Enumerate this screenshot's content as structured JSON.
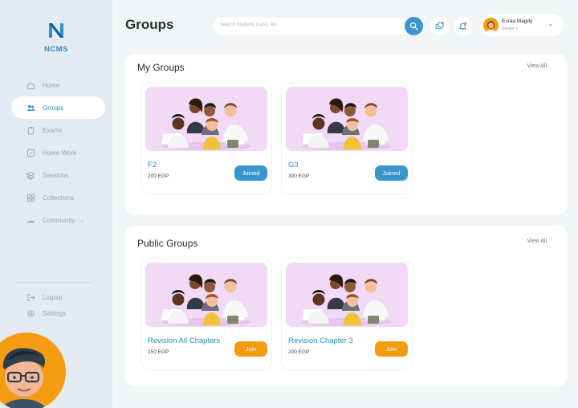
{
  "app": {
    "logo_text": "NCMS"
  },
  "sidebar": {
    "items": [
      {
        "label": "Home",
        "icon": "home-icon"
      },
      {
        "label": "Groups",
        "icon": "users-icon",
        "active": true
      },
      {
        "label": "Exams",
        "icon": "clipboard-icon"
      },
      {
        "label": "Home Work",
        "icon": "edit-icon"
      },
      {
        "label": "Sessions",
        "icon": "layers-icon"
      },
      {
        "label": "Collections",
        "icon": "grid-icon"
      },
      {
        "label": "Community",
        "icon": "broadcast-icon"
      }
    ],
    "bottom": [
      {
        "label": "Logout",
        "icon": "logout-icon"
      },
      {
        "label": "Settings",
        "icon": "gear-icon"
      }
    ]
  },
  "header": {
    "title": "Groups",
    "search_placeholder": "Search Student, Class, etc",
    "user": {
      "name": "Esraa Magdy",
      "role": "Senior 1"
    }
  },
  "my_groups": {
    "title": "My Groups",
    "view_all": "View All",
    "cards": [
      {
        "name": "F2",
        "price": "200 EGP",
        "action": "Joined"
      },
      {
        "name": "G3",
        "price": "300 EGP",
        "action": "Joined"
      }
    ]
  },
  "public_groups": {
    "title": "Public Groups",
    "view_all": "View All",
    "cards": [
      {
        "name": "Revision All Chapters",
        "price": "150 EGP",
        "action": "Join"
      },
      {
        "name": "Revision Chapter 3",
        "price": "200 EGP",
        "action": "Join"
      }
    ]
  },
  "colors": {
    "accent": "#3b96cf",
    "orange": "#f39a0e",
    "sidebar": "#e3eaf2"
  }
}
